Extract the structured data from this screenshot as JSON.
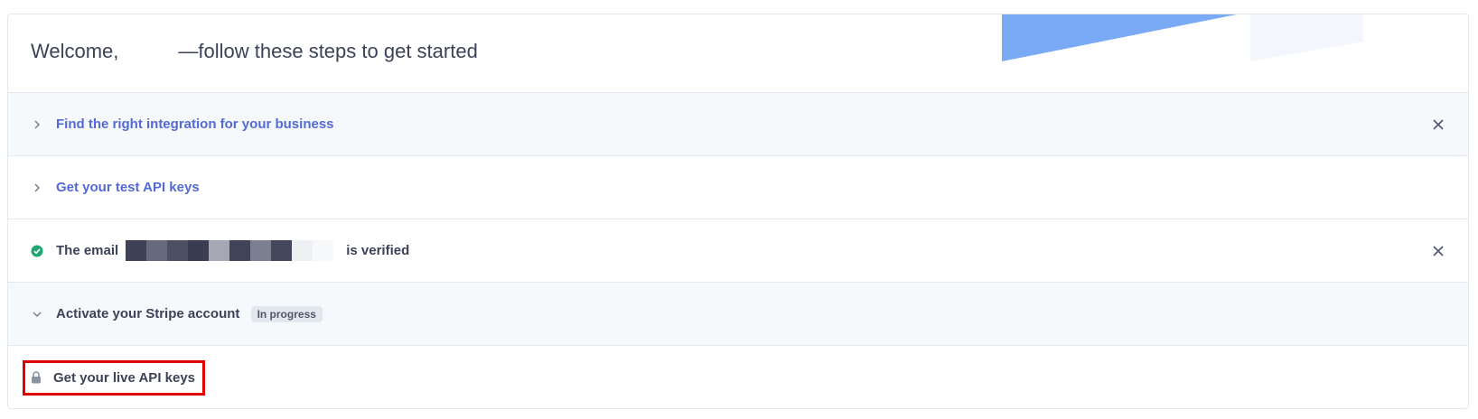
{
  "header": {
    "welcome_prefix": "Welcome,",
    "welcome_suffix": "—follow these steps to get started"
  },
  "steps": [
    {
      "label": "Find the right integration for your business",
      "icon": "chevron-right-icon",
      "dismissible": true
    },
    {
      "label": "Get your test API keys",
      "icon": "chevron-right-icon",
      "dismissible": false
    },
    {
      "label_prefix": "The email",
      "label_suffix": "is verified",
      "icon": "check-circle-icon",
      "dismissible": true
    },
    {
      "label": "Activate your Stripe account",
      "badge": "In progress",
      "icon": "chevron-down-icon",
      "dismissible": false
    },
    {
      "label": "Get your live API keys",
      "icon": "lock-icon",
      "dismissible": false
    }
  ],
  "colors": {
    "link": "#5469d4",
    "text": "#3c4257",
    "success": "#1ea672",
    "highlight": "#e00000",
    "decor_blue": "#7aaaf5"
  }
}
